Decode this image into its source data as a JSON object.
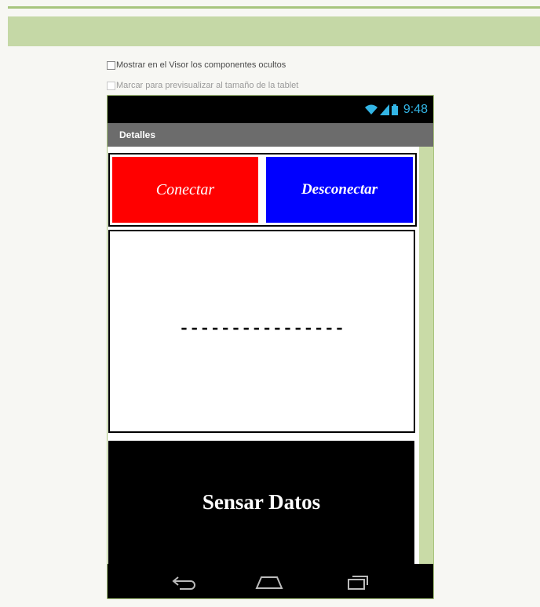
{
  "options": {
    "show_hidden": "Mostrar en el Visor los componentes ocultos",
    "tablet_preview": "Marcar para previsualizar al tamaño de la tablet"
  },
  "status_bar": {
    "time": "9:48",
    "icons": [
      "wifi-icon",
      "signal-icon",
      "battery-icon"
    ]
  },
  "app": {
    "title": "Detalles",
    "connect_label": "Conectar",
    "disconnect_label": "Desconectar",
    "data_value": "----------------",
    "sense_label": "Sensar Datos"
  },
  "navigation": [
    "back-icon",
    "home-icon",
    "recent-apps-icon"
  ],
  "colors": {
    "connect_button": "#ff0000",
    "disconnect_button": "#0000ff",
    "sense_button": "#000000",
    "action_bar": "#6c6c6c",
    "accent_green": "#c5d8a6",
    "status_blue": "#33b5e5"
  }
}
